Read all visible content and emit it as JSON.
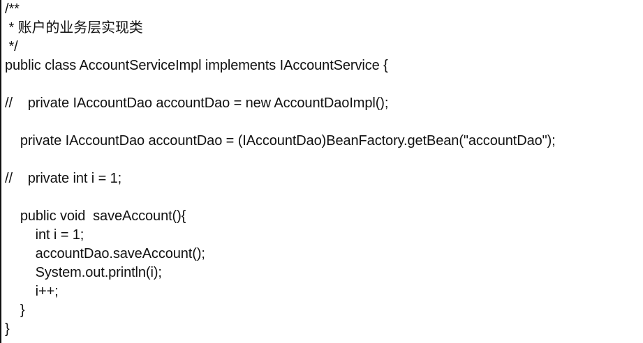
{
  "code": {
    "lines": [
      "/**",
      " * 账户的业务层实现类",
      " */",
      "public class AccountServiceImpl implements IAccountService {",
      "",
      "//    private IAccountDao accountDao = new AccountDaoImpl();",
      "",
      "    private IAccountDao accountDao = (IAccountDao)BeanFactory.getBean(\"accountDao\");",
      "",
      "//    private int i = 1;",
      "",
      "    public void  saveAccount(){",
      "        int i = 1;",
      "        accountDao.saveAccount();",
      "        System.out.println(i);",
      "        i++;",
      "    }",
      "}"
    ]
  }
}
